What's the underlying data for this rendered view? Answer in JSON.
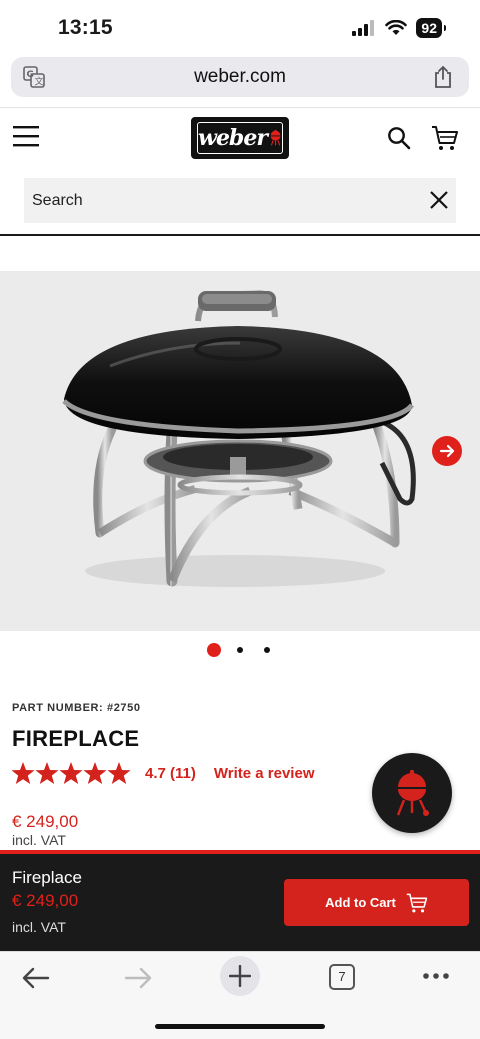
{
  "status_bar": {
    "time": "13:15",
    "battery": "92"
  },
  "browser": {
    "url": "weber.com",
    "tab_count": "7"
  },
  "header": {
    "logo_text": "weber"
  },
  "search": {
    "placeholder": "Search"
  },
  "product": {
    "part_number": "PART NUMBER: #2750",
    "title": "FIREPLACE",
    "rating": 4.7,
    "rating_text": "4.7 (11)",
    "review_link": "Write a review",
    "price": "€ 249,00",
    "vat": "incl. VAT"
  },
  "carousel": {
    "slide_count": 3,
    "active_index": 0
  },
  "sticky_bar": {
    "name": "Fireplace",
    "price": "€ 249,00",
    "vat": "incl. VAT",
    "button_label": "Add to Cart"
  },
  "colors": {
    "brand_red": "#e0201b",
    "dark": "#1a1a1a"
  },
  "icons": [
    "translate-icon",
    "share-icon",
    "menu-icon",
    "search-icon",
    "cart-icon",
    "close-icon",
    "arrow-right-icon",
    "star-icon",
    "grill-icon",
    "back-icon",
    "forward-icon",
    "plus-icon",
    "more-icon"
  ]
}
